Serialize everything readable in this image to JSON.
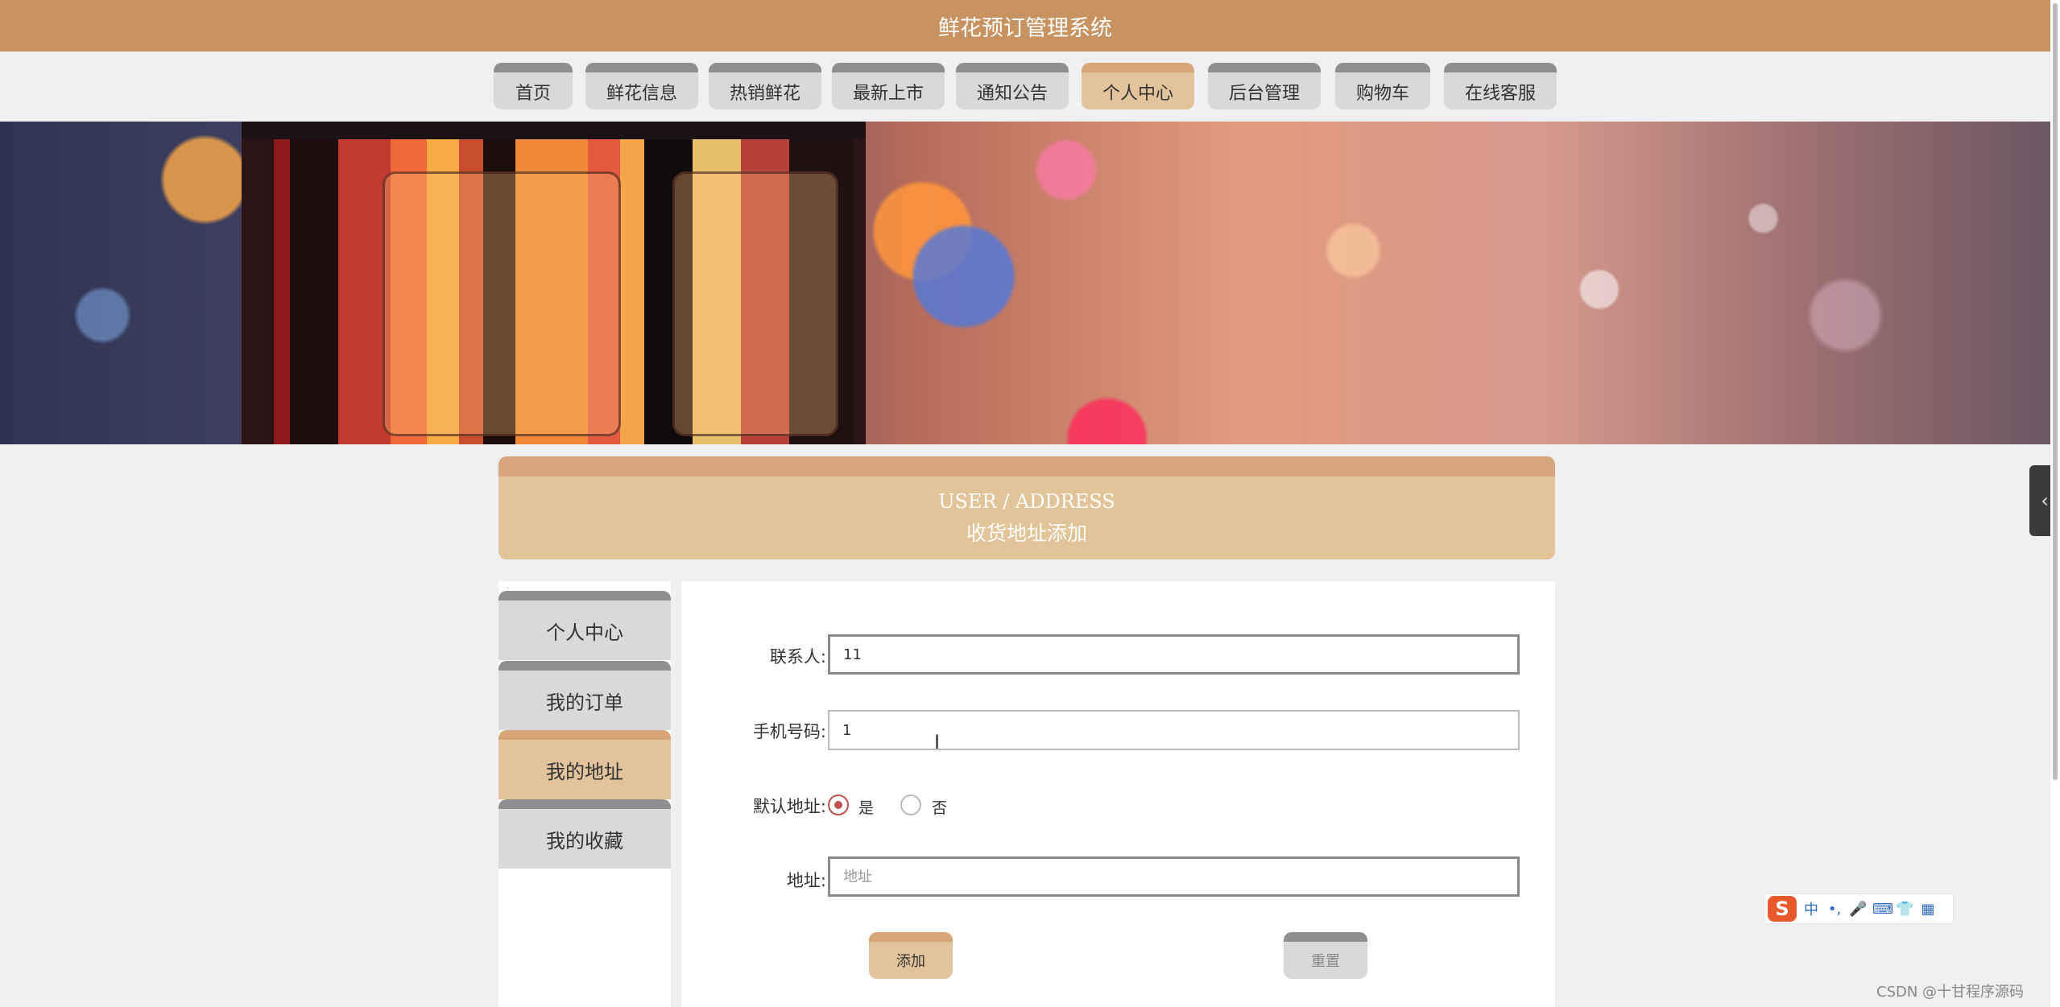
{
  "header": {
    "title": "鲜花预订管理系统"
  },
  "nav": {
    "items": [
      {
        "label": "首页"
      },
      {
        "label": "鲜花信息"
      },
      {
        "label": "热销鲜花"
      },
      {
        "label": "最新上市"
      },
      {
        "label": "通知公告"
      },
      {
        "label": "个人中心"
      },
      {
        "label": "后台管理"
      },
      {
        "label": "购物车"
      },
      {
        "label": "在线客服"
      }
    ],
    "active_label": "个人中心"
  },
  "section": {
    "title_en": "USER / ADDRESS",
    "title_cn": "收货地址添加"
  },
  "sidebar": {
    "items": [
      {
        "label": "个人中心"
      },
      {
        "label": "我的订单"
      },
      {
        "label": "我的地址"
      },
      {
        "label": "我的收藏"
      }
    ],
    "active_label": "我的地址"
  },
  "form": {
    "contact": {
      "label": "联系人:",
      "value": "11"
    },
    "phone": {
      "label": "手机号码:",
      "value": "1"
    },
    "default_address": {
      "label": "默认地址:",
      "options": [
        "是",
        "否"
      ],
      "selected": "是"
    },
    "address": {
      "label": "地址:",
      "value": "",
      "placeholder": "地址"
    },
    "add_label": "添加",
    "reset_label": "重置"
  },
  "ime_toolbar": {
    "logo": "S",
    "items": [
      "中",
      "•,",
      "🎤",
      "⌨",
      "👕",
      "▦"
    ]
  },
  "watermark": "CSDN @十甘程序源码",
  "colors": {
    "primary": "#c89360",
    "accent": "#e3c39b",
    "accent_top": "#d9a67a",
    "neutral": "#d9d9db",
    "neutral_top": "#8f8f91"
  }
}
